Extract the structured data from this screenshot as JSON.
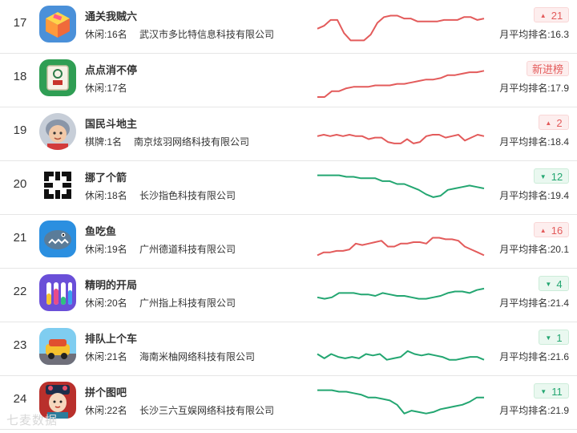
{
  "colors": {
    "up": "#e35b5b",
    "down": "#23a671"
  },
  "rows": [
    {
      "rank": "17",
      "title": "通关我贼六",
      "category": "休闲:16名",
      "developer": "武汉市多比特信息科技有限公司",
      "badge": "21",
      "trend": "up",
      "avg": "月平均排名:16.3",
      "icon": "puzzle-box-icon",
      "trend_values": [
        30,
        28,
        24,
        24,
        33,
        38,
        38,
        38,
        34,
        26,
        22,
        21,
        21,
        23,
        23,
        25,
        25,
        25,
        25,
        24,
        24,
        24,
        22,
        22,
        24,
        23
      ]
    },
    {
      "rank": "18",
      "title": "点点消不停",
      "category": "休闲:17名",
      "developer": "",
      "badge": "新进榜",
      "trend": "new",
      "avg": "月平均排名:17.9",
      "icon": "mahjong-tile-icon",
      "trend_values": [
        40,
        40,
        36,
        36,
        34,
        33,
        33,
        33,
        32,
        32,
        32,
        31,
        31,
        30,
        29,
        28,
        28,
        27,
        25,
        25,
        24,
        23,
        23,
        22
      ]
    },
    {
      "rank": "19",
      "title": "国民斗地主",
      "category": "棋牌:1名",
      "developer": "南京炫羽网络科技有限公司",
      "badge": "2",
      "trend": "up",
      "avg": "月平均排名:18.4",
      "icon": "poker-character-icon",
      "trend_values": [
        30,
        29,
        30,
        29,
        30,
        29,
        30,
        30,
        32,
        31,
        31,
        34,
        35,
        35,
        32,
        35,
        34,
        30,
        29,
        29,
        31,
        30,
        29,
        33,
        31,
        29,
        30
      ]
    },
    {
      "rank": "20",
      "title": "挪了个箭",
      "category": "休闲:18名",
      "developer": "长沙指色科技有限公司",
      "badge": "12",
      "trend": "down",
      "avg": "月平均排名:19.4",
      "icon": "arrow-maze-icon",
      "trend_values": [
        20,
        20,
        20,
        20,
        21,
        21,
        22,
        22,
        22,
        24,
        24,
        26,
        26,
        28,
        30,
        33,
        35,
        34,
        30,
        29,
        28,
        27,
        28,
        29
      ]
    },
    {
      "rank": "21",
      "title": "鱼吃鱼",
      "category": "休闲:19名",
      "developer": "广州德道科技有限公司",
      "badge": "16",
      "trend": "up",
      "avg": "月平均排名:20.1",
      "icon": "shark-icon",
      "trend_values": [
        38,
        36,
        36,
        35,
        35,
        34,
        30,
        31,
        30,
        29,
        28,
        32,
        32,
        30,
        30,
        29,
        29,
        30,
        26,
        26,
        27,
        27,
        28,
        32,
        34,
        36,
        38
      ]
    },
    {
      "rank": "22",
      "title": "精明的开局",
      "category": "休闲:20名",
      "developer": "广州指上科技有限公司",
      "badge": "4",
      "trend": "down",
      "avg": "月平均排名:21.4",
      "icon": "color-tubes-icon",
      "trend_values": [
        30,
        31,
        30,
        27,
        27,
        27,
        28,
        28,
        29,
        27,
        28,
        29,
        29,
        30,
        31,
        31,
        30,
        29,
        27,
        26,
        26,
        27,
        25,
        24
      ]
    },
    {
      "rank": "23",
      "title": "排队上个车",
      "category": "休闲:21名",
      "developer": "海南米柚网络科技有限公司",
      "badge": "1",
      "trend": "down",
      "avg": "月平均排名:21.6",
      "icon": "traffic-car-icon",
      "trend_values": [
        32,
        35,
        32,
        34,
        35,
        34,
        35,
        32,
        33,
        32,
        36,
        35,
        34,
        30,
        32,
        33,
        32,
        33,
        34,
        36,
        36,
        35,
        34,
        34,
        36
      ]
    },
    {
      "rank": "24",
      "title": "拼个图吧",
      "category": "休闲:22名",
      "developer": "长沙三六互娱网络科技有限公司",
      "badge": "11",
      "trend": "down",
      "avg": "月平均排名:21.9",
      "icon": "qing-lady-icon",
      "trend_values": [
        20,
        20,
        20,
        21,
        21,
        22,
        23,
        25,
        25,
        26,
        27,
        30,
        36,
        34,
        35,
        36,
        35,
        33,
        32,
        31,
        30,
        28,
        25,
        25
      ]
    }
  ],
  "watermark": "七麦数据"
}
